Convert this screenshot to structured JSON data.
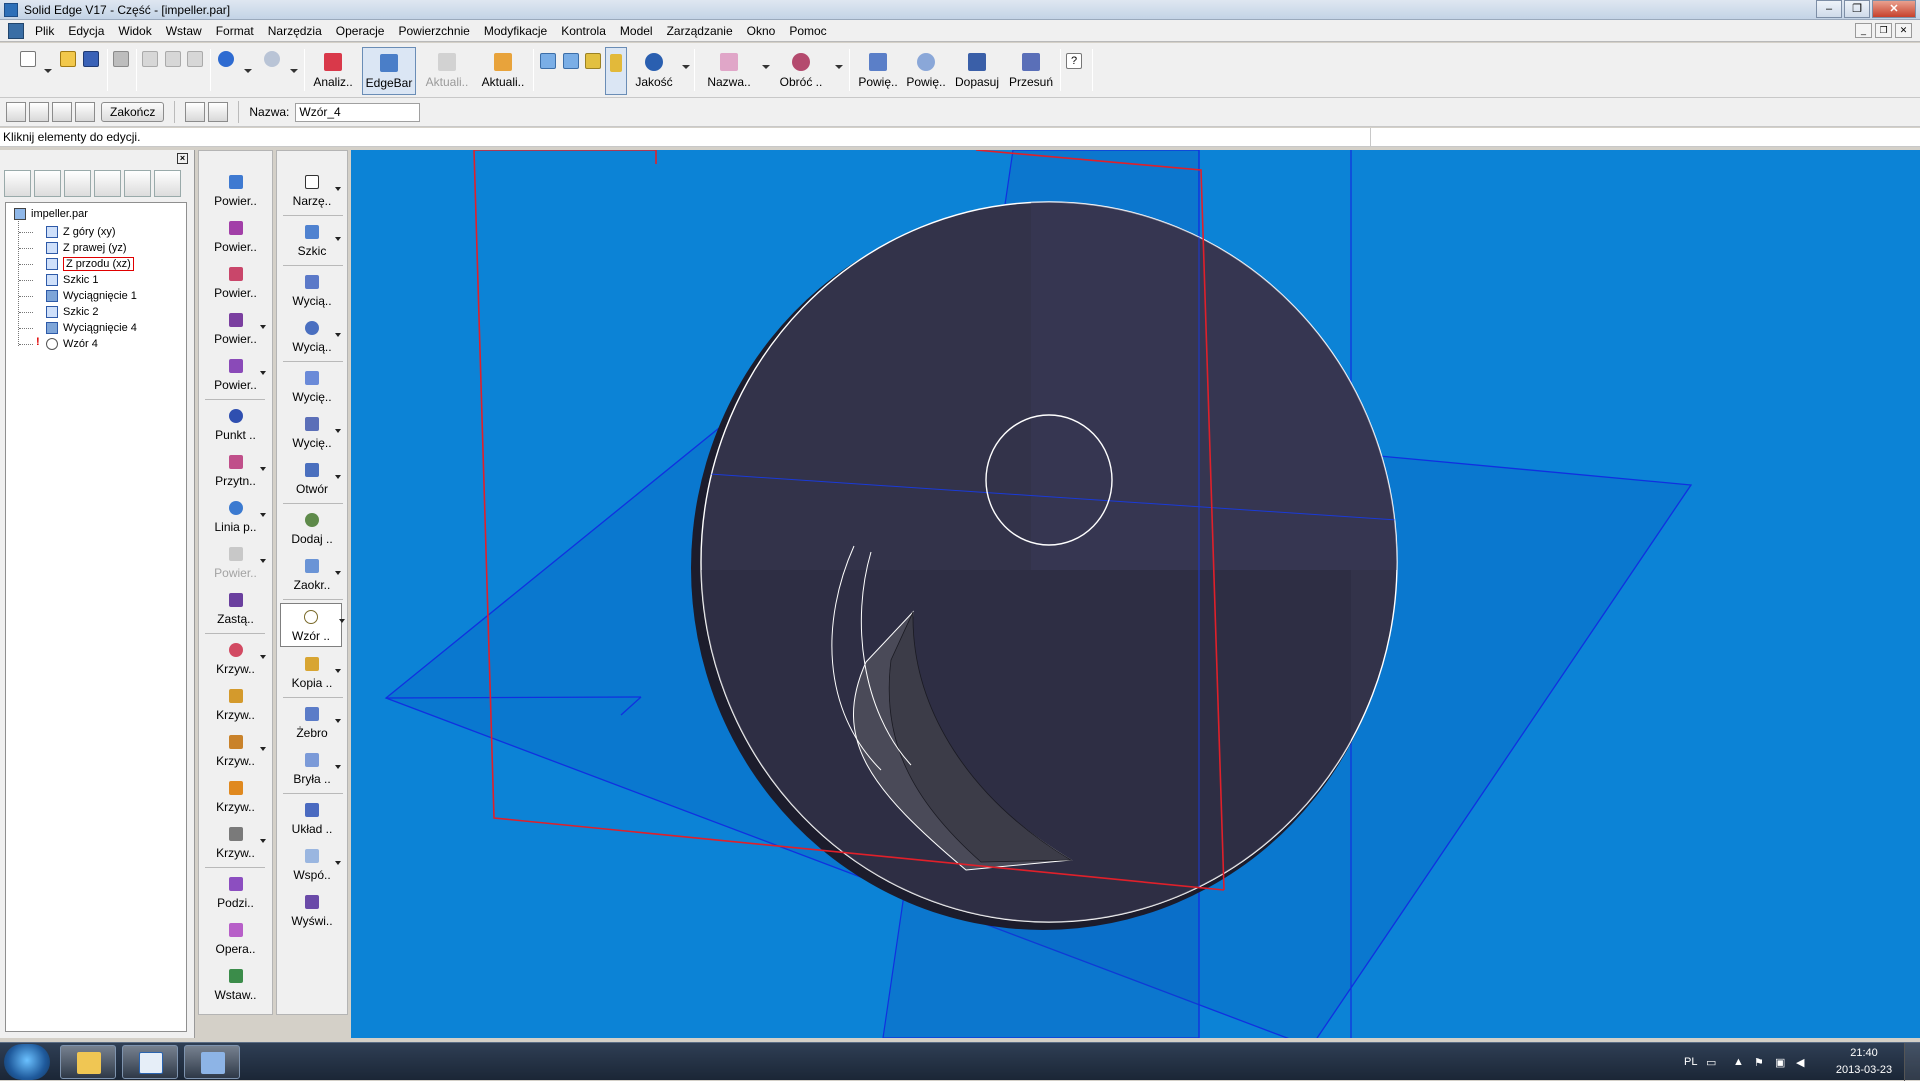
{
  "window": {
    "title": "Solid Edge V17 - Część - [impeller.par]"
  },
  "menu": {
    "items": [
      "Plik",
      "Edycja",
      "Widok",
      "Wstaw",
      "Format",
      "Narzędzia",
      "Operacje",
      "Powierzchnie",
      "Modyfikacje",
      "Kontrola",
      "Model",
      "Zarządzanie",
      "Okno",
      "Pomoc"
    ]
  },
  "toolbar": {
    "analyze": "Analiz..",
    "edgebar": "EdgeBar",
    "update_disabled": "Aktuali..",
    "update": "Aktuali..",
    "quality": "Jakość",
    "name": "Nazwa..",
    "rotate": "Obróć ..",
    "zoom_area": "Powię..",
    "zoom": "Powię..",
    "fit": "Dopasuj",
    "pan": "Przesuń"
  },
  "ribbon": {
    "finish": "Zakończ",
    "name_label": "Nazwa:",
    "name_value": "Wzór_4"
  },
  "prompt": "Kliknij elementy do edycji.",
  "tree": {
    "root": "impeller.par",
    "items": [
      "Z góry (xy)",
      "Z prawej (yz)",
      "Z przodu (xz)",
      "Szkic 1",
      "Wyciągnięcie 1",
      "Szkic 2",
      "Wyciągnięcie 4",
      "Wzór 4"
    ],
    "error_mark": "!"
  },
  "features_col1": [
    "Powier..",
    "Powier..",
    "Powier..",
    "Powier..",
    "Powier..",
    "Punkt ..",
    "Przytn..",
    "Linia p..",
    "Powier..",
    "Zastą..",
    "Krzyw..",
    "Krzyw..",
    "Krzyw..",
    "Krzyw..",
    "Krzyw..",
    "Podzi..",
    "Opera..",
    "Wstaw.."
  ],
  "features_col2": [
    "Narzę..",
    "Szkic",
    "Wycią..",
    "Wycią..",
    "Wycię..",
    "Wycię..",
    "Otwór",
    "Dodaj ..",
    "Zaokr..",
    "Wzór ..",
    "Kopia ..",
    "Żebro",
    "Bryła ..",
    "Układ ..",
    "Wspó..",
    "Wyświ.."
  ],
  "taskbar": {
    "lang": "PL",
    "time": "21:40",
    "date": "2013-03-23"
  },
  "colors": {
    "viewport": "#0c83d6",
    "plane_red": "#e0202a",
    "plane_blue": "#1030e0",
    "body": "#33334a"
  }
}
